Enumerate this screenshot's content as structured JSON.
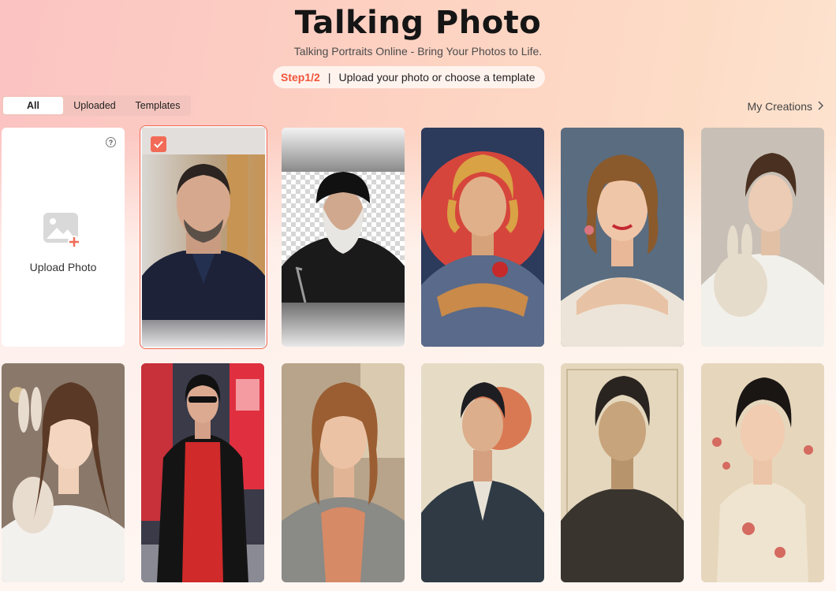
{
  "header": {
    "title": "Talking Photo",
    "subtitle": "Talking Portraits Online - Bring Your Photos to Life.",
    "step_badge": "Step1/2",
    "step_separator": "|",
    "step_text": "Upload your photo or choose a template"
  },
  "tabs": [
    {
      "label": "All",
      "active": true
    },
    {
      "label": "Uploaded",
      "active": false
    },
    {
      "label": "Templates",
      "active": false
    }
  ],
  "my_creations": {
    "label": "My Creations",
    "icon": "chevron-right-icon"
  },
  "upload_card": {
    "label": "Upload Photo",
    "help_icon": "question-icon",
    "icon": "image-plus-icon"
  },
  "colors": {
    "accent": "#f26b57",
    "step_badge": "#f0563a"
  },
  "templates": [
    {
      "name": "photo-man-suit",
      "selected": true
    },
    {
      "name": "photo-cleric-transparent",
      "selected": false
    },
    {
      "name": "template-painted-man-rose",
      "selected": false
    },
    {
      "name": "template-vintage-woman-pinup",
      "selected": false
    },
    {
      "name": "template-boy-rabbit",
      "selected": false
    },
    {
      "name": "template-girl-rabbit",
      "selected": false
    },
    {
      "name": "template-woman-leather-jacket",
      "selected": false
    },
    {
      "name": "template-woman-sunlight",
      "selected": false
    },
    {
      "name": "template-painted-man-suit",
      "selected": false
    },
    {
      "name": "template-sketch-man",
      "selected": false
    },
    {
      "name": "template-woman-cheongsam",
      "selected": false
    }
  ]
}
